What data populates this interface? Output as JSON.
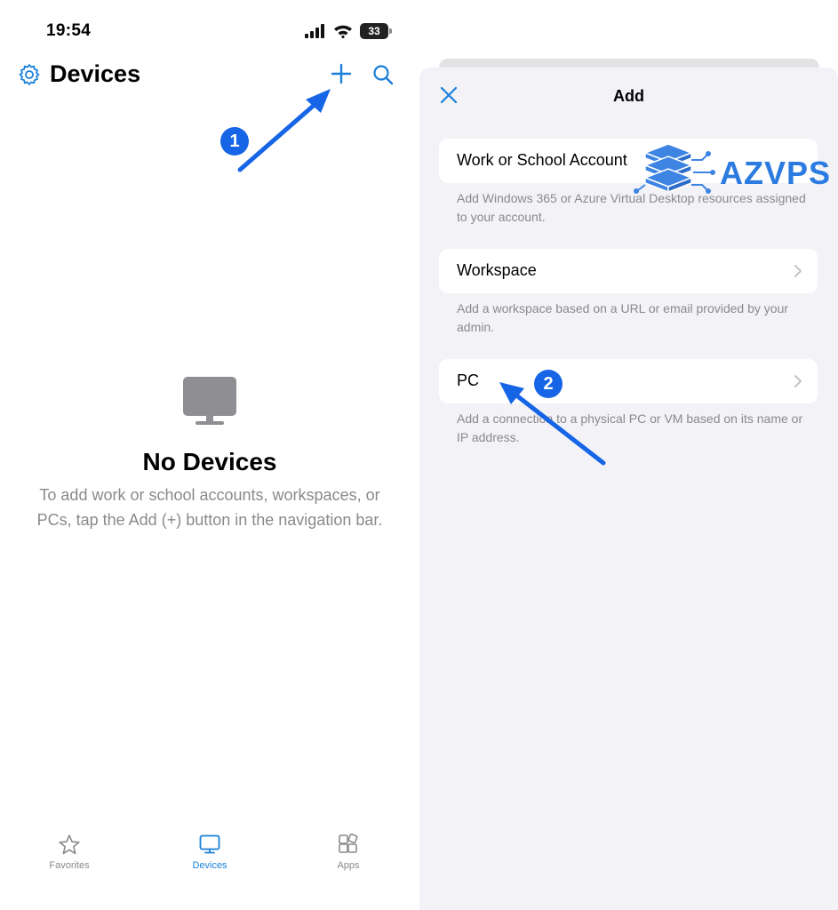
{
  "left": {
    "status": {
      "time": "19:54",
      "battery": "33"
    },
    "header": {
      "title": "Devices"
    },
    "empty_state": {
      "title": "No Devices",
      "message": "To add work or school accounts, workspaces, or PCs, tap the Add (+) button in the navigation bar."
    },
    "tabs": [
      {
        "label": "Favorites",
        "icon": "star-icon"
      },
      {
        "label": "Devices",
        "icon": "monitor-icon",
        "active": true
      },
      {
        "label": "Apps",
        "icon": "apps-icon"
      }
    ]
  },
  "right": {
    "sheet": {
      "title": "Add",
      "items": [
        {
          "label": "Work or School Account",
          "description": "Add Windows 365 or Azure Virtual Desktop resources assigned to your account."
        },
        {
          "label": "Workspace",
          "description": "Add a workspace based on a URL or email provided by your admin."
        },
        {
          "label": "PC",
          "description": "Add a connection to a physical PC or VM based on its name or IP address."
        }
      ]
    }
  },
  "annotations": {
    "step1": "1",
    "step2": "2"
  },
  "watermark": {
    "text": "AZVPS"
  },
  "colors": {
    "accent": "#1a7fd8",
    "annotation": "#1565e6",
    "secondary_text": "#8a8a8e",
    "sheet_bg": "#f2f2f7"
  }
}
